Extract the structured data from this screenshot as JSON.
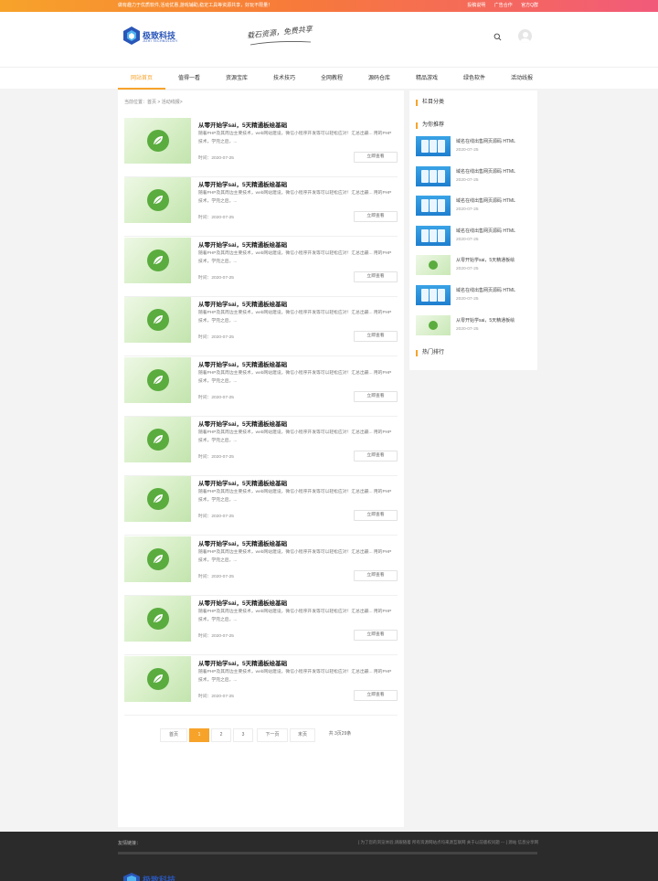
{
  "colors": {
    "accent": "#f7a32a",
    "brand": "#2a56b8",
    "leaf": "#5aac3e"
  },
  "topbar": {
    "slogan": "做有趣力于优质软件,活动优惠,游戏辅助,稳定工具等资源共享，好玩不限量！",
    "links": [
      "投稿说明",
      "广告合作",
      "官方Q群"
    ]
  },
  "header": {
    "logo_name": "极致科技",
    "logo_sub": "JIZHI TECHNOLOGY",
    "motto": "载石资源，免费共享",
    "icons": [
      "search-icon",
      "user-avatar-icon"
    ]
  },
  "nav": {
    "items": [
      "网站首页",
      "值得一看",
      "资源宝库",
      "技术技巧",
      "全网教程",
      "源码仓库",
      "精品游戏",
      "绿色软件",
      "活动线报"
    ]
  },
  "main": {
    "breadcrumb": "当前位置：首页 > 活动线报>",
    "articles": [
      {
        "title": "从零开始学sai，5天精通板绘基础",
        "desc": "随着PHP及其周边主要技术，web网站建设，微信小程序开发等可以轻松应对！汇总出最... 用的PHP技术，学完之后，...",
        "time": "时间：2020-07-25",
        "button": "立即查看"
      },
      {
        "title": "从零开始学sai，5天精通板绘基础",
        "desc": "随着PHP及其周边主要技术，web网站建设，微信小程序开发等可以轻松应对！汇总出最... 用的PHP技术，学完之后，...",
        "time": "时间：2020-07-25",
        "button": "立即查看"
      },
      {
        "title": "从零开始学sai，5天精通板绘基础",
        "desc": "随着PHP及其周边主要技术，web网站建设，微信小程序开发等可以轻松应对！汇总出最... 用的PHP技术，学完之后，...",
        "time": "时间：2020-07-25",
        "button": "立即查看"
      },
      {
        "title": "从零开始学sai，5天精通板绘基础",
        "desc": "随着PHP及其周边主要技术，web网站建设，微信小程序开发等可以轻松应对！汇总出最... 用的PHP技术，学完之后，...",
        "time": "时间：2020-07-25",
        "button": "立即查看"
      },
      {
        "title": "从零开始学sai，5天精通板绘基础",
        "desc": "随着PHP及其周边主要技术，web网站建设，微信小程序开发等可以轻松应对！汇总出最... 用的PHP技术，学完之后，...",
        "time": "时间：2020-07-25",
        "button": "立即查看"
      },
      {
        "title": "从零开始学sai，5天精通板绘基础",
        "desc": "随着PHP及其周边主要技术，web网站建设，微信小程序开发等可以轻松应对！汇总出最... 用的PHP技术，学完之后，...",
        "time": "时间：2020-07-25",
        "button": "立即查看"
      },
      {
        "title": "从零开始学sai，5天精通板绘基础",
        "desc": "随着PHP及其周边主要技术，web网站建设，微信小程序开发等可以轻松应对！汇总出最... 用的PHP技术，学完之后，...",
        "time": "时间：2020-07-25",
        "button": "立即查看"
      },
      {
        "title": "从零开始学sai，5天精通板绘基础",
        "desc": "随着PHP及其周边主要技术，web网站建设，微信小程序开发等可以轻松应对！汇总出最... 用的PHP技术，学完之后，...",
        "time": "时间：2020-07-25",
        "button": "立即查看"
      },
      {
        "title": "从零开始学sai，5天精通板绘基础",
        "desc": "随着PHP及其周边主要技术，web网站建设，微信小程序开发等可以轻松应对！汇总出最... 用的PHP技术，学完之后，...",
        "time": "时间：2020-07-25",
        "button": "立即查看"
      },
      {
        "title": "从零开始学sai，5天精通板绘基础",
        "desc": "随着PHP及其周边主要技术，web网站建设，微信小程序开发等可以轻松应对！汇总出最... 用的PHP技术，学完之后，...",
        "time": "时间：2020-07-25",
        "button": "立即查看"
      }
    ],
    "pagination": {
      "items": [
        {
          "label": "首页",
          "active": false
        },
        {
          "label": "1",
          "active": true
        },
        {
          "label": "2",
          "active": false
        },
        {
          "label": "3",
          "active": false
        },
        {
          "label": "下一页",
          "active": false
        },
        {
          "label": "末页",
          "active": false
        },
        {
          "label": "共 3页29条",
          "active": false
        }
      ]
    }
  },
  "sidebar": {
    "category_heading": "栏目分类",
    "recommend_heading": "为你推荐",
    "hot_heading": "热门排行",
    "recommend": [
      {
        "title": "域名在线出售网页源码 HTML",
        "date": "2020-07-25",
        "thumb": "blue"
      },
      {
        "title": "域名在线出售网页源码 HTML",
        "date": "2020-07-25",
        "thumb": "blue"
      },
      {
        "title": "域名在线出售网页源码 HTML",
        "date": "2020-07-25",
        "thumb": "blue"
      },
      {
        "title": "域名在线出售网页源码 HTML",
        "date": "2020-07-25",
        "thumb": "blue"
      },
      {
        "title": "从零开始学sai，5天精通板绘",
        "date": "2020-07-25",
        "thumb": "green"
      },
      {
        "title": "域名在线出售网页源码 HTML",
        "date": "2020-07-25",
        "thumb": "blue"
      },
      {
        "title": "从零开始学sai，5天精通板绘",
        "date": "2020-07-25",
        "thumb": "green"
      }
    ]
  },
  "footer": {
    "label": "友情链接：",
    "text": "[ 为了您的浏览体验,请跟随着 所有资源网站点均来源互联网 关于以前版权问题 --- ] 源站 信息分享网 ",
    "logo_name": "极致科技"
  }
}
